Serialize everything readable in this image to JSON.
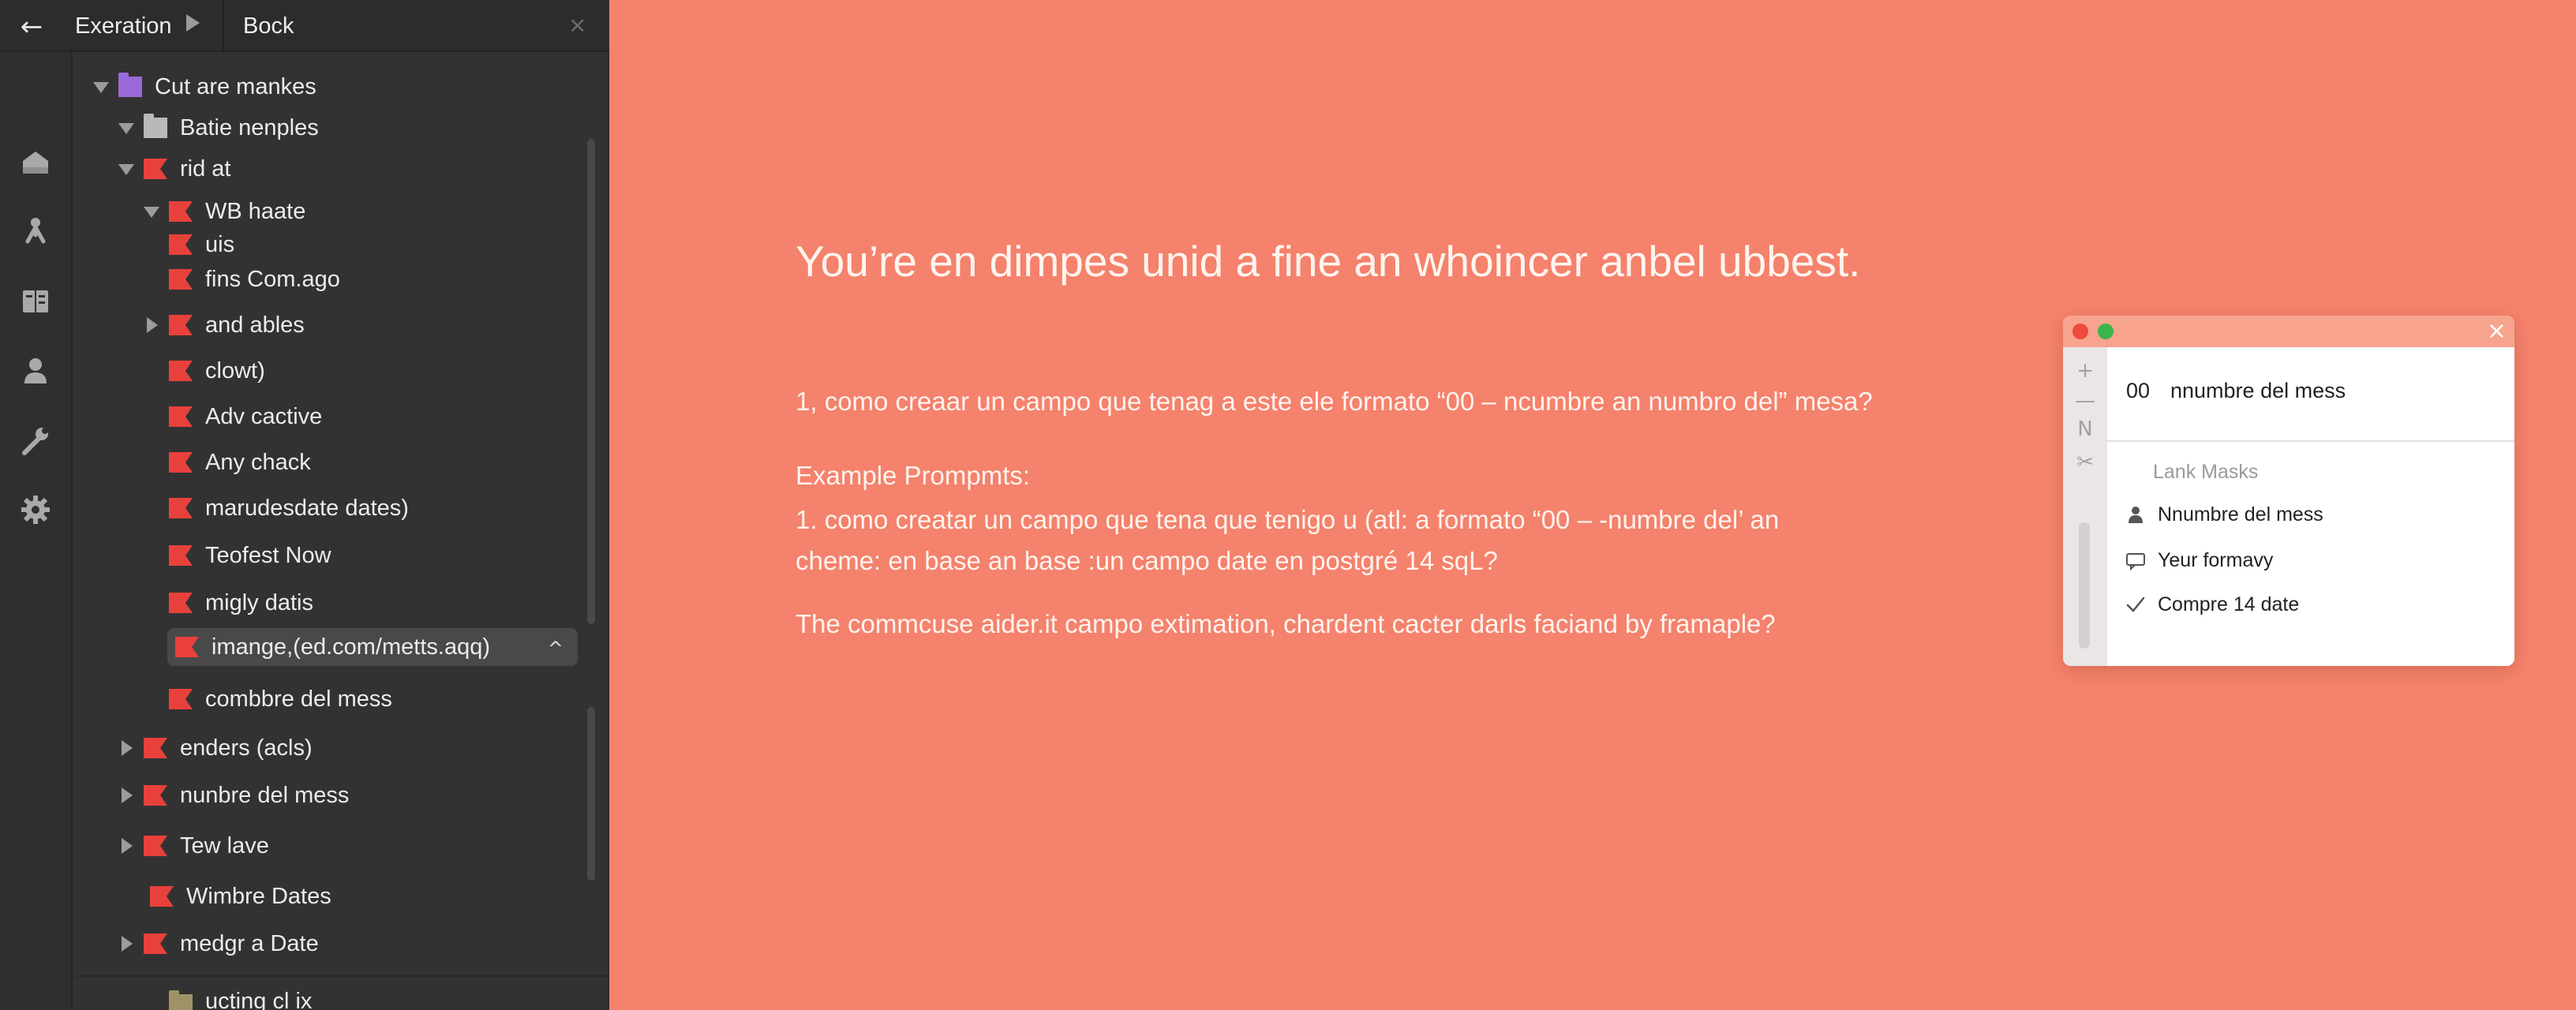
{
  "topbar": {
    "back_icon": "arrow-left-icon",
    "crumb_1": "Exeration",
    "crumb_2": "Bock",
    "close_label": "×"
  },
  "rail_icons": [
    "home-icon",
    "person-walk-icon",
    "book-icon",
    "user-icon",
    "wrench-icon",
    "gear-icon"
  ],
  "tree": {
    "items": [
      {
        "label": "Cut are mankes",
        "expander": "down",
        "folder": "purple"
      },
      {
        "label": "Batie nenples",
        "expander": "down",
        "folder": "grey"
      },
      {
        "label": "rid at",
        "expander": "down",
        "folder": "red"
      },
      {
        "label": "WB haate",
        "expander": "down",
        "folder": "red"
      },
      {
        "label": "uis",
        "expander": "none",
        "folder": "red"
      },
      {
        "label": "fins Com.ago",
        "expander": "none",
        "folder": "red"
      },
      {
        "label": "and ables",
        "expander": "right",
        "folder": "red"
      },
      {
        "label": "clowt)",
        "expander": "none",
        "folder": "red"
      },
      {
        "label": "Adv cactive",
        "expander": "none",
        "folder": "red"
      },
      {
        "label": "Any chack",
        "expander": "none",
        "folder": "red"
      },
      {
        "label": "marudesdate dates)",
        "expander": "none",
        "folder": "red"
      },
      {
        "label": "Teofest Now",
        "expander": "none",
        "folder": "red"
      },
      {
        "label": "migly datis",
        "expander": "none",
        "folder": "red"
      },
      {
        "label": "imange,(ed.com/metts.aqq)",
        "expander": "none",
        "folder": "red",
        "selected": true
      },
      {
        "label": "combbre del mess",
        "expander": "none",
        "folder": "red"
      },
      {
        "label": "enders (acls)",
        "expander": "right",
        "folder": "red"
      },
      {
        "label": "nunbre del mess",
        "expander": "right",
        "folder": "red"
      },
      {
        "label": "Tew lave",
        "expander": "right",
        "folder": "red"
      },
      {
        "label": "Wimbre Dates",
        "expander": "none",
        "folder": "red"
      },
      {
        "label": "medgr a Date",
        "expander": "right",
        "folder": "red"
      },
      {
        "label": "ucting cl ix",
        "expander": "none",
        "folder": "olive"
      }
    ],
    "selected_caret": "^"
  },
  "main": {
    "headline": "You’re en dimpes unid a fine an whoincer anbel ubbest.",
    "question": "1, como creaar un campo que tenag a este ele formato “00 – ncumbre an numbro del” mesa?",
    "examples_title": "Example Prompmts:",
    "example_line_1": "1. como creatar un campo que tena que tenigo u (atl: a formato  “00 – -numbre del’ an",
    "example_line_2": "cheme: en base an base :un campo date en postgré 14 sqL?",
    "example_line_3": "The commcuse aider.it campo extimation, chardent cacter darls faciand by framaple?"
  },
  "popup": {
    "close_label": "×",
    "tools": [
      "+",
      "—",
      "N",
      "✂"
    ],
    "input_number": "00",
    "input_text": "nnumbre del mess",
    "section_title": "Lank Masks",
    "rows": [
      {
        "icon": "person-icon",
        "label": "Nnumbre del mess"
      },
      {
        "icon": "comment-icon",
        "label": "Yeur formavy"
      },
      {
        "icon": "check-icon",
        "label": "Compre 14 date"
      }
    ]
  },
  "colors": {
    "background": "#f4826c",
    "panel": "#333232",
    "folder_red": "#e8413b",
    "folder_purple": "#9a6ad8"
  }
}
